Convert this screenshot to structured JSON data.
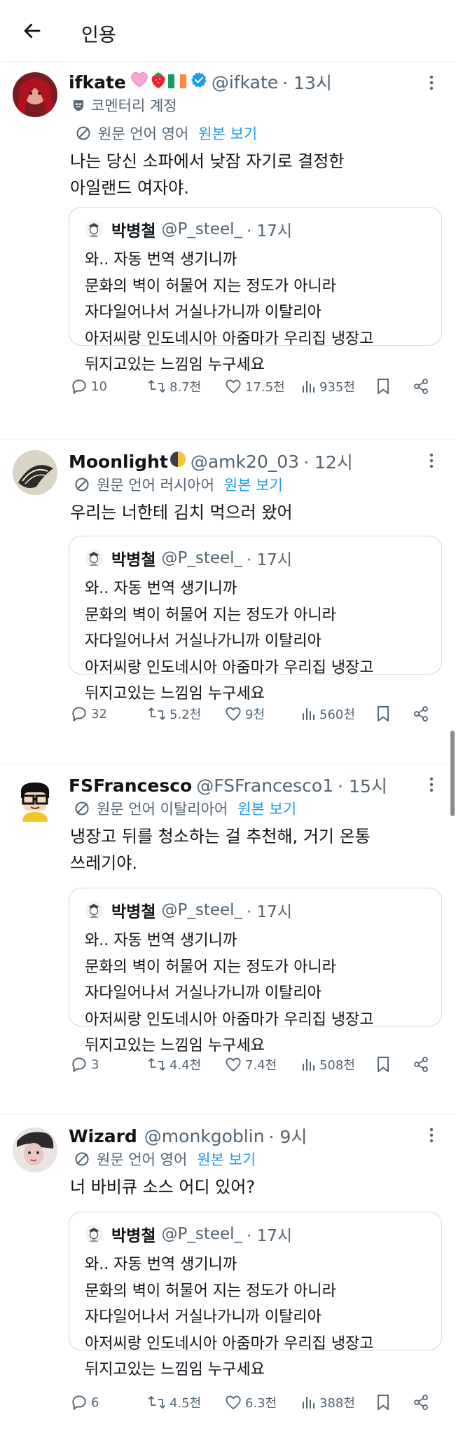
{
  "header": {
    "title": "인용",
    "back_icon": "arrow-left-icon"
  },
  "colors": {
    "link": "#1d9bf0",
    "muted": "#536471",
    "border": "#cfd9de",
    "verified": "#1d9bf0"
  },
  "quoted_tweet": {
    "name": "박병철",
    "handle": "@P_steel_",
    "time": "· 17시",
    "text": "와.. 자동 번역 생기니까\n문화의 벽이 허물어 지는 정도가 아니라\n자다일어나서 거실나가니까 이탈리아\n아저씨랑 인도네시아 아줌마가 우리집 냉장고\n뒤지고있는 느낌임 누구세요"
  },
  "tweets": [
    {
      "name": "ifkate",
      "handle": "@ifkate",
      "time": "· 13시",
      "account_label": "코멘터리 계정",
      "translation": "원문 언어 영어",
      "show_original": "원본 보기",
      "text": "나는 당신 소파에서 낮잠 자기로 결정한\n아일랜드 여자야.",
      "stats": {
        "replies": "10",
        "retweets": "8.7천",
        "likes": "17.5천",
        "views": "935천"
      }
    },
    {
      "name": "Moonlight",
      "handle": "@amk20_03",
      "time": "· 12시",
      "translation": "원문 언어 러시아어",
      "show_original": "원본 보기",
      "text": "우리는 너한테 김치 먹으러 왔어",
      "stats": {
        "replies": "32",
        "retweets": "5.2천",
        "likes": "9천",
        "views": "560천"
      }
    },
    {
      "name": "FSFrancesco",
      "handle": "@FSFrancesco1",
      "time": "· 15시",
      "translation": "원문 언어 이탈리아어",
      "show_original": "원본 보기",
      "text": "냉장고 뒤를 청소하는 걸 추천해, 거기 온통\n쓰레기야.",
      "stats": {
        "replies": "3",
        "retweets": "4.4천",
        "likes": "7.4천",
        "views": "508천"
      }
    },
    {
      "name": "Wizard",
      "handle": "@monkgoblin",
      "time": "· 9시",
      "translation": "원문 언어 영어",
      "show_original": "원본 보기",
      "text": "너 바비큐 소스 어디 있어?",
      "stats": {
        "replies": "6",
        "retweets": "4.5천",
        "likes": "6.3천",
        "views": "388천"
      }
    }
  ]
}
